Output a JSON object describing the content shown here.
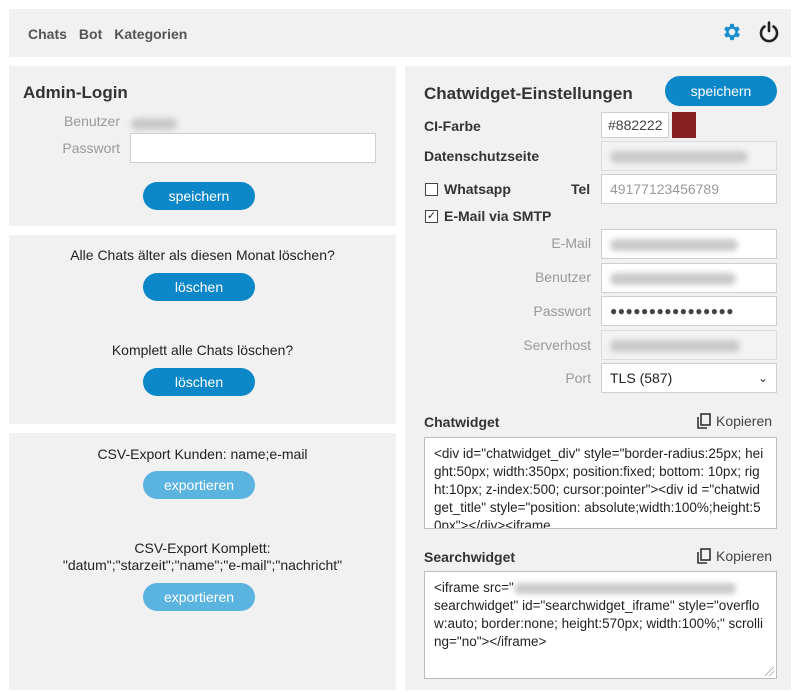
{
  "nav": {
    "items": [
      "Chats",
      "Bot",
      "Kategorien"
    ]
  },
  "icons": {
    "settings": "gear-icon",
    "power": "power-icon"
  },
  "colors": {
    "accent": "#0c87c8",
    "accent_light": "#5bb4e0",
    "ci_swatch": "#882222"
  },
  "login": {
    "title": "Admin-Login",
    "user_label": "Benutzer",
    "password_label": "Passwort",
    "password_value": "",
    "save_label": "speichern"
  },
  "delete": {
    "old_question": "Alle Chats älter als diesen Monat löschen?",
    "old_button": "löschen",
    "all_question": "Komplett alle Chats löschen?",
    "all_button": "löschen"
  },
  "export": {
    "customers_label": "CSV-Export Kunden: name;e-mail",
    "customers_button": "exportieren",
    "full_label_line1": "CSV-Export Komplett:",
    "full_label_line2": "\"datum\";\"starzeit\";\"name\";\"e-mail\";\"nachricht\"",
    "full_button": "exportieren"
  },
  "settings": {
    "title": "Chatwidget-Einstellungen",
    "save_label": "speichern",
    "ci_label": "CI-Farbe",
    "ci_value": "#882222",
    "privacy_label": "Datenschutzseite",
    "whatsapp_label": "Whatsapp",
    "tel_label": "Tel",
    "tel_value": "49177123456789",
    "smtp_label": "E-Mail via SMTP",
    "smtp_check": "✓",
    "email_label": "E-Mail",
    "user_label": "Benutzer",
    "password_label": "Passwort",
    "password_value": "●●●●●●●●●●●●●●●●",
    "host_label": "Serverhost",
    "port_label": "Port",
    "port_value": "TLS (587)",
    "chatwidget_label": "Chatwidget",
    "copy_label": "Kopieren",
    "chatwidget_code": "<div id=\"chatwidget_div\" style=\"border-radius:25px; height:50px; width:350px; position:fixed; bottom: 10px;  right:10px; z-index:500; cursor:pointer\"><div id =\"chatwidget_title\" style=\"position: absolute;width:100%;height:50px\"></div><iframe",
    "searchwidget_label": "Searchwidget",
    "search_copy_label": "Kopieren",
    "searchwidget_code_start": "<iframe src=\"",
    "searchwidget_code_rest": "searchwidget\" id=\"searchwidget_iframe\" style=\"overflow:auto; border:none; height:570px; width:100%;\" scrolling=\"no\"></iframe>"
  }
}
